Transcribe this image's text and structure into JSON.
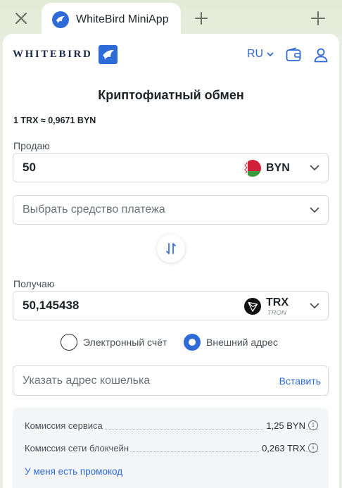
{
  "browser": {
    "tab_title": "WhiteBird MiniApp",
    "close_icon": "close-icon",
    "new_tab_icon": "plus-icon",
    "menu_icon": "collapse-icon"
  },
  "header": {
    "logo_text": "WHITEBIRD",
    "language": "RU",
    "wallet_icon": "wallet-icon",
    "profile_icon": "user-icon"
  },
  "page": {
    "title": "Криптофиатный обмен",
    "rate": "1 TRX ≈ 0,9671 BYN"
  },
  "sell": {
    "label": "Продаю",
    "amount": "50",
    "currency": "BYN",
    "payment_placeholder": "Выбрать средство платежа"
  },
  "receive": {
    "label": "Получаю",
    "amount": "50,145438",
    "currency": "TRX",
    "network": "TRON"
  },
  "destination": {
    "option_e_account": "Электронный счёт",
    "option_external": "Внешний адрес",
    "selected": "external",
    "address_placeholder": "Указать адрес кошелька",
    "paste_label": "Вставить"
  },
  "fees": {
    "service_label": "Комиссия сервиса",
    "service_value": "1,25 BYN",
    "network_label": "Комиссия сети блокчейн",
    "network_value": "0,263 TRX",
    "promo_label": "У меня есть промокод"
  },
  "colors": {
    "accent": "#2f6bd8",
    "chrome_bg": "#e7eddc"
  }
}
